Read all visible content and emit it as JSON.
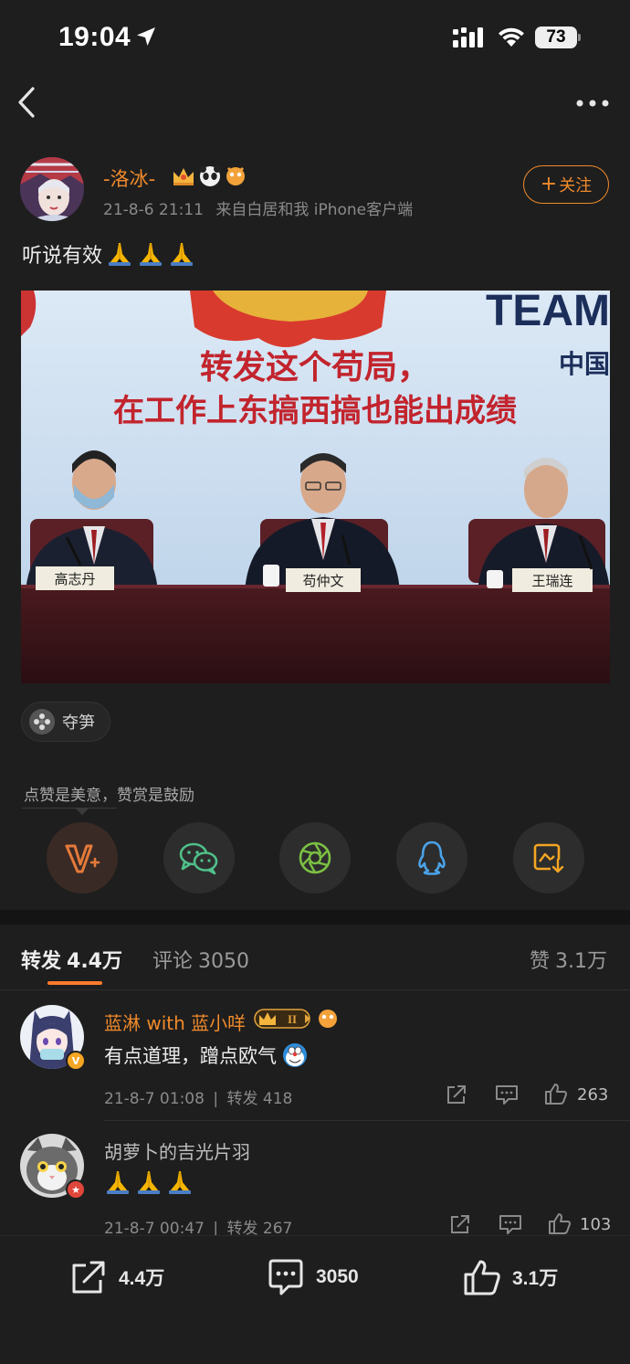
{
  "status_bar": {
    "time": "19:04",
    "battery": "73"
  },
  "post": {
    "author": "-洛冰-",
    "timestamp": "21-8-6 21:11",
    "source": "来自白居和我 iPhone客户端",
    "follow_label": "关注",
    "text": "听说有效",
    "emoji_count": 3,
    "image": {
      "banner_line1": "转发这个苟局，",
      "banner_line2": "在工作上东搞西搞也能出成绩",
      "logo_text": "TEAM",
      "logo_sub": "中国",
      "nameplates": [
        "高志丹",
        "苟仲文",
        "王瑞连"
      ]
    },
    "topic": "夺笋",
    "reward_tip": "点赞是美意，赞赏是鼓励"
  },
  "share_buttons": [
    "reward",
    "wechat",
    "moments",
    "qq",
    "save-image"
  ],
  "tabs": {
    "repost_label": "转发",
    "repost_count": "4.4万",
    "comment_label": "评论",
    "comment_count": "3050",
    "like_label": "赞",
    "like_count": "3.1万"
  },
  "comments": [
    {
      "name": "蓝淋 with 蓝小咩",
      "text": "有点道理，蹭点欧气",
      "time": "21-8-7 01:08",
      "repost": "转发 418",
      "likes": "263",
      "level_badge": "II"
    },
    {
      "name": "胡萝卜的吉光片羽",
      "text": "",
      "time": "21-8-7 00:47",
      "repost": "转发 267",
      "likes": "103"
    }
  ],
  "bottom_bar": {
    "repost": "4.4万",
    "comment": "3050",
    "like": "3.1万"
  },
  "colors": {
    "accent": "#f08a2b",
    "background": "#1e1e1e",
    "tab_indicator": "#ff7a2e"
  }
}
